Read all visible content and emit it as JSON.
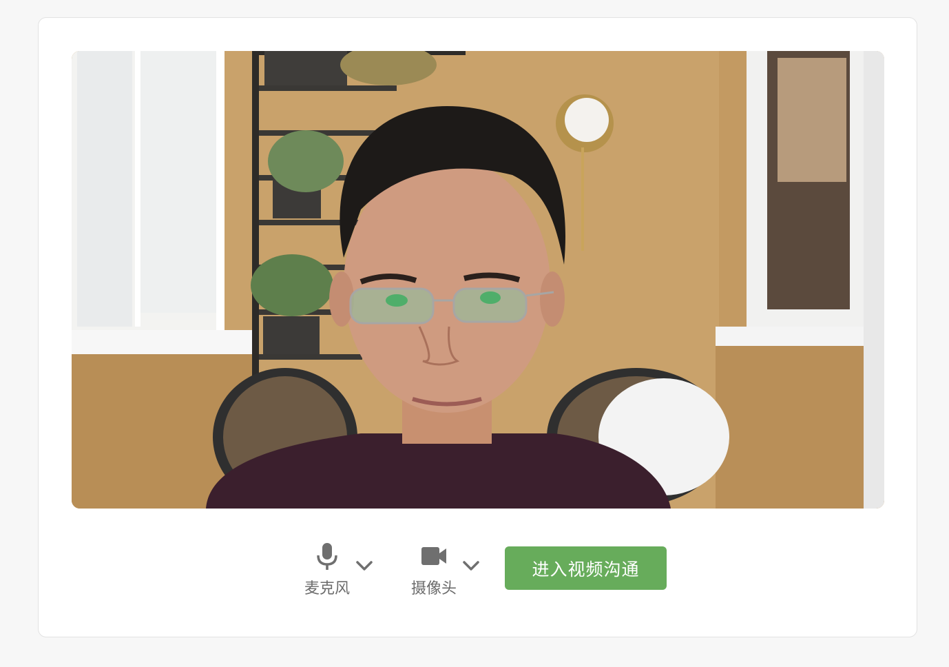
{
  "preview": {
    "description_icon": "camera-preview",
    "wall_color": "#c39a62"
  },
  "controls": {
    "microphone": {
      "icon": "microphone-icon",
      "label": "麦克风",
      "dropdown_icon": "chevron-down-icon"
    },
    "camera": {
      "icon": "video-camera-icon",
      "label": "摄像头",
      "dropdown_icon": "chevron-down-icon"
    },
    "join_button": {
      "label": "进入视频沟通",
      "color": "#67ac5b"
    }
  }
}
